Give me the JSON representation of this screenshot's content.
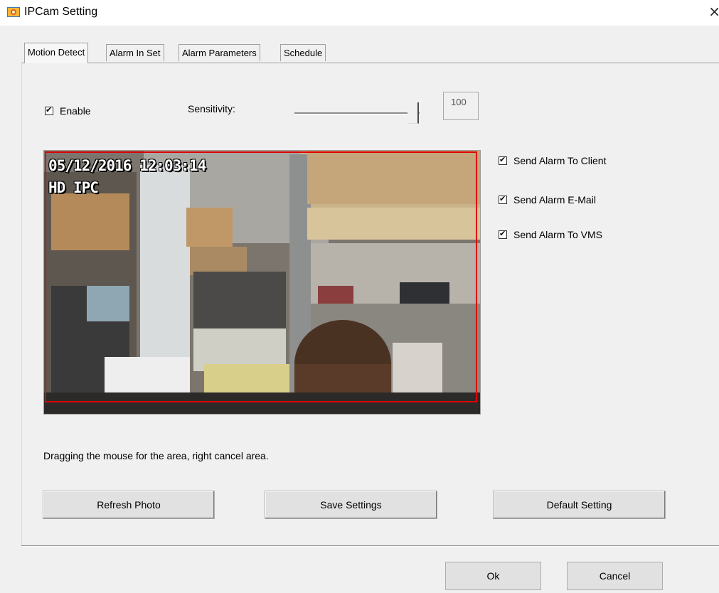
{
  "window": {
    "title": "IPCam Setting",
    "close_glyph": "×",
    "icon": "app-camera-icon"
  },
  "tabs": [
    {
      "label": "Motion Detect",
      "active": true
    },
    {
      "label": "Alarm In Set",
      "active": false
    },
    {
      "label": "Alarm Parameters",
      "active": false
    },
    {
      "label": "Schedule",
      "active": false
    }
  ],
  "motion": {
    "enable_label": "Enable",
    "enable_checked": true,
    "sensitivity_label": "Sensitivity:",
    "sensitivity_value": "100",
    "sensitivity_level": 1.0
  },
  "camera": {
    "osd_datetime": "05/12/2016 12:03:14",
    "osd_name": "HD IPC",
    "motion_area_color": "#e00000"
  },
  "alarms": [
    {
      "label": "Send Alarm To Client",
      "checked": true
    },
    {
      "label": "Send Alarm E-Mail",
      "checked": true
    },
    {
      "label": "Send Alarm To VMS",
      "checked": true
    }
  ],
  "hint_text": "Dragging the mouse for the area, right cancel area.",
  "actions": {
    "refresh": "Refresh Photo",
    "save": "Save Settings",
    "default": "Default Setting"
  },
  "dialog": {
    "ok": "Ok",
    "cancel": "Cancel"
  }
}
